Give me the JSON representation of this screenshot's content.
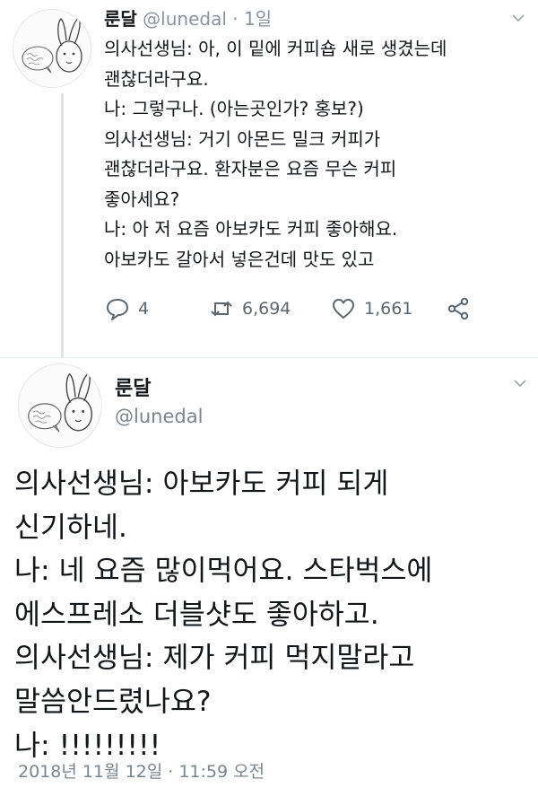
{
  "reply_tweet": {
    "author_name": "룬달",
    "handle": "@lunedal",
    "separator": "·",
    "time": "1일",
    "text_lines": [
      "의사선생님: 아, 이 밑에 커피숍 새로 생겼는데",
      "괜찮더라구요.",
      "나: 그렇구나. (아는곳인가? 홍보?)",
      "의사선생님: 거기 아몬드 밀크 커피가",
      "괜찮더라구요. 환자분은 요즘 무슨 커피",
      "좋아세요?",
      "나: 아 저 요즘 아보카도 커피 좋아해요.",
      "아보카도 갈아서 넣은건데 맛도 있고"
    ],
    "actions": {
      "reply_count": "4",
      "retweet_count": "6,694",
      "like_count": "1,661"
    }
  },
  "main_tweet": {
    "author_name": "룬달",
    "handle": "@lunedal",
    "text_lines": [
      "의사선생님: 아보카도 커피 되게",
      "신기하네.",
      "나: 네 요즘 많이먹어요. 스타벅스에",
      "에스프레소 더블샷도 좋아하고.",
      "의사선생님: 제가 커피 먹지말라고",
      "말씀안드렸나요?",
      "나: !!!!!!!!!"
    ],
    "timestamp": "2018년 11월 12일 · 11:59 오전"
  },
  "icons": {
    "reply": "reply-bubble-icon",
    "retweet": "retweet-icon",
    "like": "heart-icon",
    "share": "share-icon",
    "menu": "chevron-down-icon"
  },
  "colors": {
    "text": "#14171a",
    "muted": "#8a949e",
    "action": "#5c6770",
    "thread_line": "#dfe3e6"
  }
}
